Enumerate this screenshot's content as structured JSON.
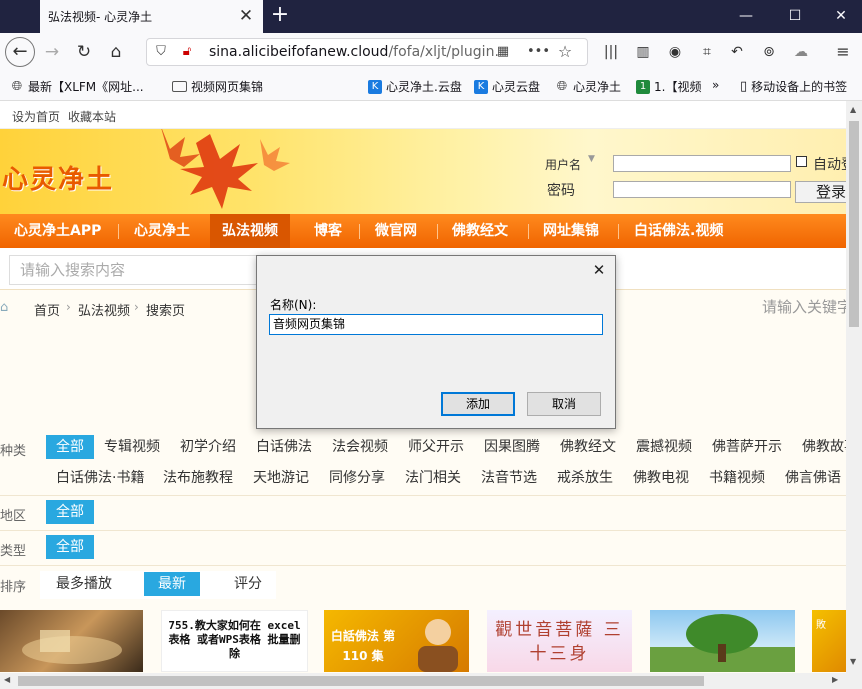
{
  "browser": {
    "tab_title": "弘法视频- 心灵净土",
    "tab_close": "✕",
    "new_tab": "+",
    "window": {
      "minimize": "—",
      "maximize": "☐",
      "close": "✕"
    },
    "url_host": "sina.alicibeifofanew.cloud",
    "url_path": "/fofa/xljt/plugin.p",
    "bookmarks": [
      {
        "label": "最新【XLFM《网址..."
      },
      {
        "label": "视频网页集锦"
      },
      {
        "label": "心灵净土.云盘"
      },
      {
        "label": "心灵云盘"
      },
      {
        "label": "心灵净土"
      },
      {
        "label": "1.【视频"
      },
      {
        "label": "移动设备上的书签"
      }
    ],
    "overflow": "»"
  },
  "site": {
    "top_links": [
      "设为首页",
      "收藏本站"
    ],
    "logo": "心灵净土",
    "login": {
      "username_label": "用户名",
      "password_label": "密码",
      "auto_label": "自动登",
      "login_button": "登录"
    },
    "menu": [
      "心灵净土APP",
      "心灵净土",
      "弘法视频",
      "博客",
      "微官网",
      "佛教经文",
      "网址集锦",
      "白话佛法.视频"
    ],
    "active_menu": 2,
    "search_placeholder": "请输入搜索内容",
    "breadcrumb": [
      "首页",
      "弘法视频",
      "搜索页"
    ],
    "keyword_placeholder": "请输入关键字",
    "filters": {
      "category_label": "种类",
      "category_row1": [
        "全部",
        "专辑视频",
        "初学介绍",
        "白话佛法",
        "法会视频",
        "师父开示",
        "因果图腾",
        "佛教经文",
        "震撼视频",
        "佛菩萨开示",
        "佛教故事"
      ],
      "category_row2": [
        "白话佛法·书籍",
        "法布施教程",
        "天地游记",
        "同修分享",
        "法门相关",
        "法音节选",
        "戒杀放生",
        "佛教电视",
        "书籍视频",
        "佛言佛语"
      ],
      "region_label": "地区",
      "region": [
        "全部"
      ],
      "type_label": "类型",
      "type": [
        "全部"
      ],
      "sort_label": "排序",
      "sort": [
        "最多播放",
        "最新",
        "评分"
      ]
    },
    "thumbs": [
      {
        "text": ""
      },
      {
        "text": "755.教大家如何在 excel表格 或者WPS表格 批量删除"
      },
      {
        "text": "白話佛法 第 110 集"
      },
      {
        "text": "觀世音菩薩 三十三身"
      },
      {
        "text": ""
      },
      {
        "text": "敗"
      }
    ]
  },
  "dialog": {
    "label": "名称(N):",
    "value": "音频网页集锦",
    "add_button": "添加",
    "cancel_button": "取消",
    "close": "✕"
  }
}
